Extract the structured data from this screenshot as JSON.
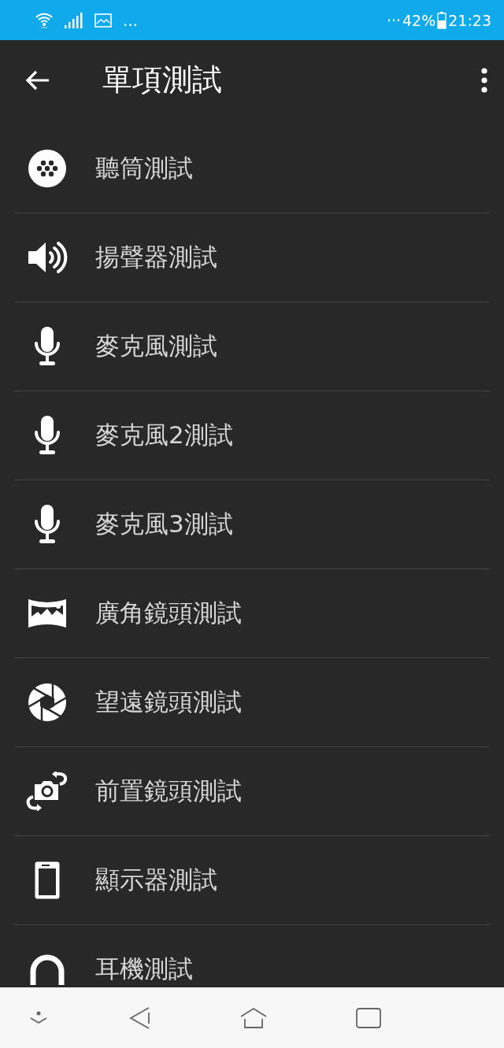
{
  "status_bar": {
    "left_more": "…",
    "right_more": "···",
    "battery": "42%",
    "time": "21:23"
  },
  "app_bar": {
    "title": "單項測試"
  },
  "items": [
    {
      "label": "聽筒測試",
      "kind": "earpiece"
    },
    {
      "label": "揚聲器測試",
      "kind": "speaker"
    },
    {
      "label": "麥克風測試",
      "kind": "mic"
    },
    {
      "label": "麥克風2測試",
      "kind": "mic"
    },
    {
      "label": "麥克風3測試",
      "kind": "mic"
    },
    {
      "label": "廣角鏡頭測試",
      "kind": "panorama"
    },
    {
      "label": "望遠鏡頭測試",
      "kind": "aperture"
    },
    {
      "label": "前置鏡頭測試",
      "kind": "camera-switch"
    },
    {
      "label": "顯示器測試",
      "kind": "phone"
    },
    {
      "label": "耳機測試",
      "kind": "headset"
    }
  ]
}
